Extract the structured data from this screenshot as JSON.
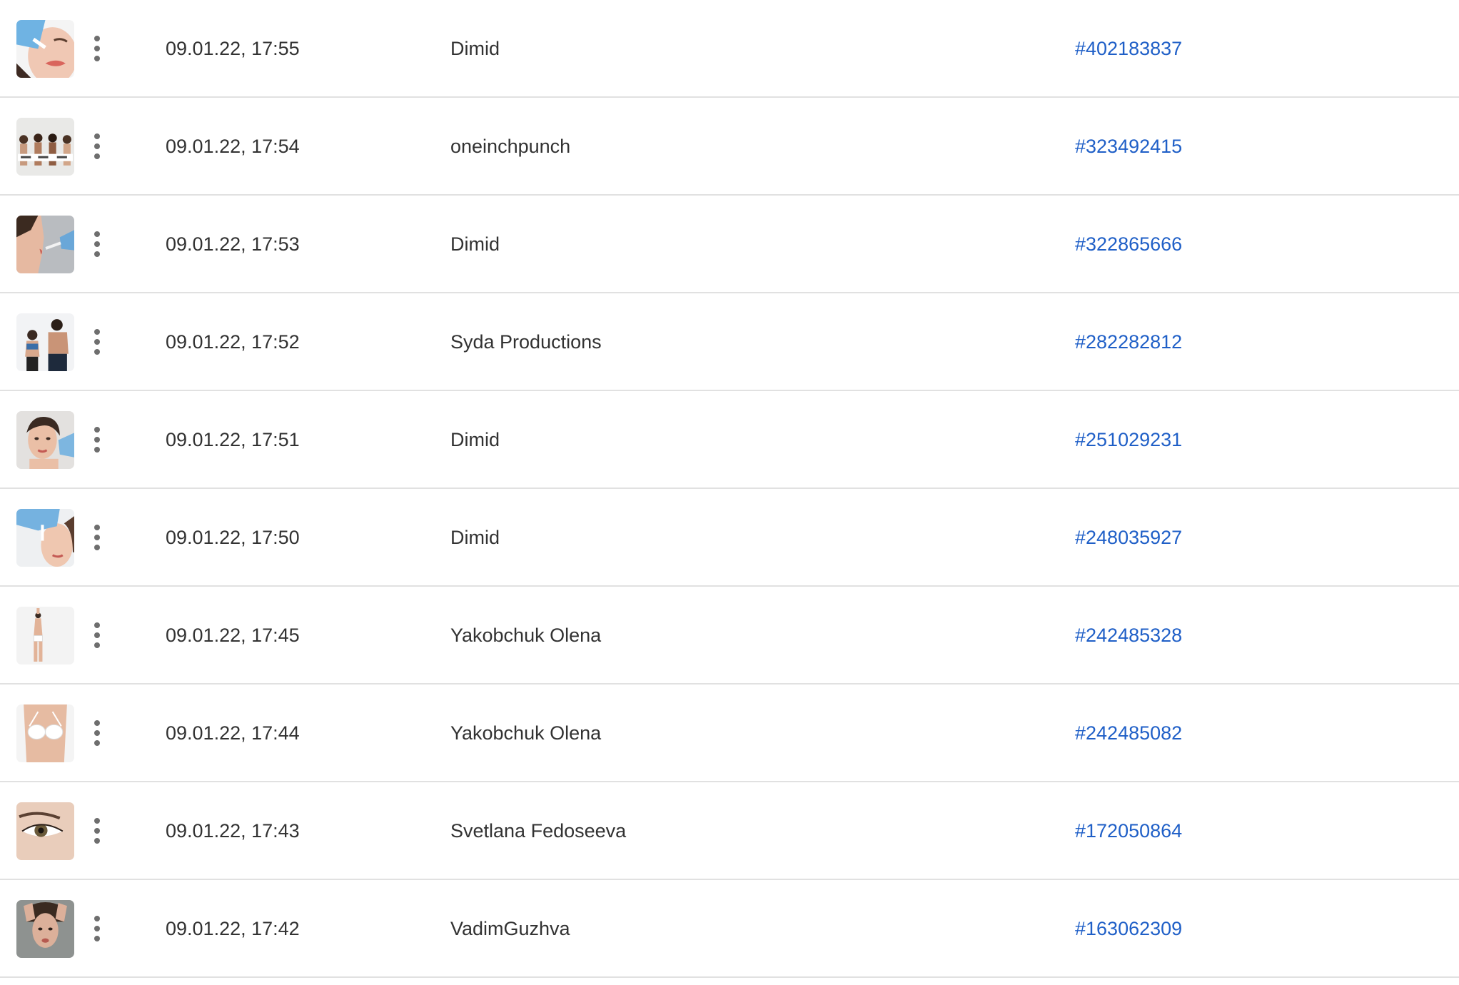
{
  "rows": [
    {
      "date": "09.01.22, 17:55",
      "author": "Dimid",
      "id": "#402183837",
      "thumb_icon": "injection-lips-photo"
    },
    {
      "date": "09.01.22, 17:54",
      "author": "oneinchpunch",
      "id": "#323492415",
      "thumb_icon": "group-of-women-photo"
    },
    {
      "date": "09.01.22, 17:53",
      "author": "Dimid",
      "id": "#322865666",
      "thumb_icon": "injection-profile-photo"
    },
    {
      "date": "09.01.22, 17:52",
      "author": "Syda Productions",
      "id": "#282282812",
      "thumb_icon": "couple-running-photo"
    },
    {
      "date": "09.01.22, 17:51",
      "author": "Dimid",
      "id": "#251029231",
      "thumb_icon": "face-injection-photo"
    },
    {
      "date": "09.01.22, 17:50",
      "author": "Dimid",
      "id": "#248035927",
      "thumb_icon": "nose-injection-photo"
    },
    {
      "date": "09.01.22, 17:45",
      "author": "Yakobchuk Olena",
      "id": "#242485328",
      "thumb_icon": "body-figure-photo"
    },
    {
      "date": "09.01.22, 17:44",
      "author": "Yakobchuk Olena",
      "id": "#242485082",
      "thumb_icon": "torso-lingerie-photo"
    },
    {
      "date": "09.01.22, 17:43",
      "author": "Svetlana Fedoseeva",
      "id": "#172050864",
      "thumb_icon": "eye-closeup-photo"
    },
    {
      "date": "09.01.22, 17:42",
      "author": "VadimGuzhva",
      "id": "#163062309",
      "thumb_icon": "woman-portrait-photo"
    }
  ],
  "colors": {
    "link": "#1f5fc7",
    "text": "#323232",
    "divider": "#e1e1e1",
    "more_icon": "#6e6e6e"
  }
}
